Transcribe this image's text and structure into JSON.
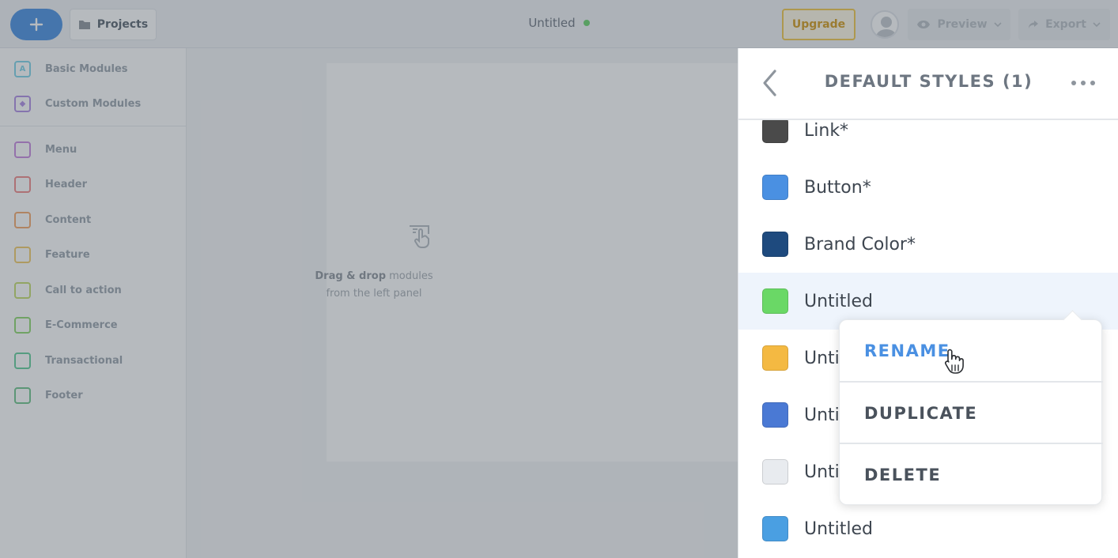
{
  "topbar": {
    "new_label": "+",
    "projects_label": "Projects",
    "doc_title": "Untitled",
    "upgrade_label": "Upgrade",
    "preview_label": "Preview",
    "export_label": "Export"
  },
  "sidebar": {
    "top_items": [
      {
        "label": "Basic Modules",
        "icon": "A",
        "color": "#7fd3e8"
      },
      {
        "label": "Custom Modules",
        "icon": "◆",
        "color": "#b18ee6"
      }
    ],
    "items": [
      {
        "label": "Menu",
        "color": "#c88ae0"
      },
      {
        "label": "Header",
        "color": "#f08a8a"
      },
      {
        "label": "Content",
        "color": "#f5a86b"
      },
      {
        "label": "Feature",
        "color": "#f3cc6a"
      },
      {
        "label": "Call to action",
        "color": "#c6dd6e"
      },
      {
        "label": "E-Commerce",
        "color": "#8fd86f"
      },
      {
        "label": "Transactional",
        "color": "#63cf9b"
      },
      {
        "label": "Footer",
        "color": "#6ec58b"
      }
    ]
  },
  "canvas": {
    "drop_bold": "Drag & drop",
    "drop_rest": " modules",
    "drop_line2": "from the left panel"
  },
  "panel": {
    "title": "DEFAULT STYLES (1)",
    "rows": [
      {
        "label": "Link*",
        "color": "#4a4a4a"
      },
      {
        "label": "Button*",
        "color": "#4a90e2"
      },
      {
        "label": "Brand Color*",
        "color": "#1e4a7e"
      },
      {
        "label": "Untitled",
        "color": "#6ad866"
      },
      {
        "label": "Untitled",
        "color": "#f4b942"
      },
      {
        "label": "Untitled",
        "color": "#4a79d4"
      },
      {
        "label": "Untitled",
        "color": "#e8ebef"
      },
      {
        "label": "Untitled",
        "color": "#4a9fe2"
      }
    ]
  },
  "context_menu": {
    "rename": "RENAME",
    "duplicate": "DUPLICATE",
    "delete": "DELETE"
  }
}
